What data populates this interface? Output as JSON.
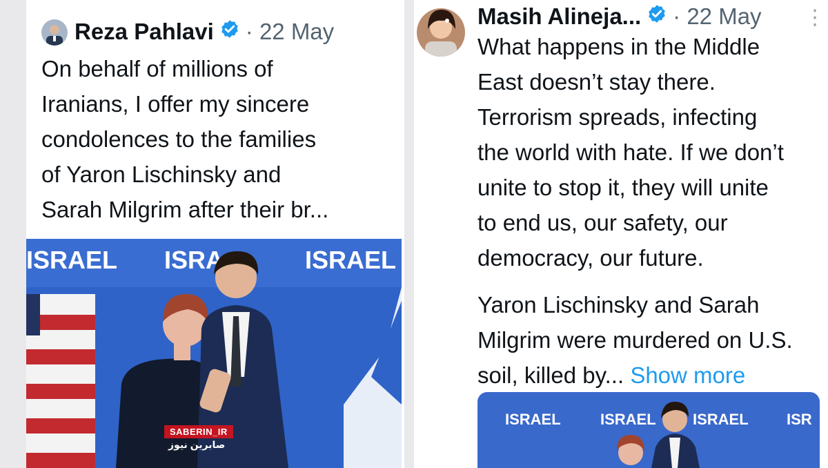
{
  "left_tweet": {
    "author_name": "Reza Pahlavi",
    "date": "· 22 May",
    "text": "On behalf of millions of\nIranians, I offer my sincere\ncondolences to the families\nof Yaron Lischinsky and\nSarah Milgrim after their br...",
    "media": {
      "banner_words": [
        "ISRAEL",
        "ISRA",
        "ISRAEL"
      ],
      "watermark": "SABERIN_IR",
      "watermark_sub": "صابرین نیوز"
    }
  },
  "right_tweet": {
    "author_name": "Masih Alineja...",
    "date": "· 22 May",
    "more_icon": "⋮",
    "text_paragraph_1": "What happens in the Middle\nEast doesn’t stay there.\nTerrorism spreads, infecting\nthe world with hate. If we don’t\nunite to stop it, they will unite\nto end us, our safety, our\ndemocracy, our future.",
    "text_paragraph_2": "Yaron Lischinsky and Sarah\nMilgrim were murdered on U.S.\nsoil, killed by...",
    "show_more": "Show more",
    "media": {
      "banner_words": [
        "ISRAEL",
        "ISRAEL",
        "ISRAEL",
        "ISR"
      ]
    }
  },
  "colors": {
    "verified": "#1d9bf0",
    "link": "#1d9bf0",
    "text": "#0f1419",
    "meta": "#536471",
    "banner_blue": "#2f63c8"
  },
  "icons": {
    "verified": "verified-badge-icon",
    "more": "more-options-icon"
  }
}
